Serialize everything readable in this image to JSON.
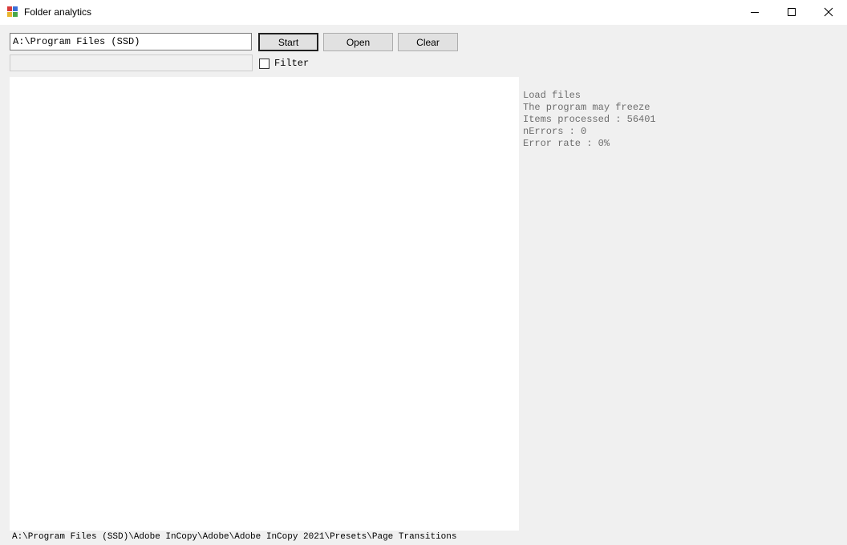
{
  "window": {
    "title": "Folder analytics"
  },
  "toolbar": {
    "path_value": "A:\\Program Files (SSD)",
    "start_label": "Start",
    "open_label": "Open",
    "clear_label": "Clear",
    "filter_value": "",
    "filter_label": "Filter",
    "filter_checked": false
  },
  "log": {
    "lines": [
      "Load files",
      "The program may freeze",
      "Items processed : 56401",
      "nErrors : 0",
      "Error rate : 0%"
    ]
  },
  "status": {
    "current_path": "A:\\Program Files (SSD)\\Adobe InCopy\\Adobe\\Adobe InCopy 2021\\Presets\\Page Transitions"
  },
  "icons": {
    "app": "folder-analytics-app-icon",
    "minimize": "minimize-icon",
    "maximize": "maximize-icon",
    "close": "close-icon"
  }
}
